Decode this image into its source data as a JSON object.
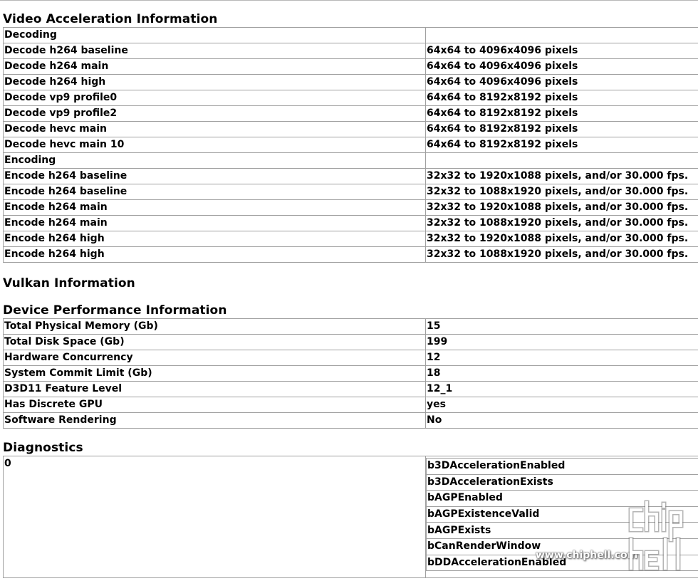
{
  "video_acceleration": {
    "heading": "Video Acceleration Information",
    "rows": [
      {
        "name": "Decoding",
        "value": ""
      },
      {
        "name": "Decode h264 baseline",
        "value": "64x64 to 4096x4096 pixels"
      },
      {
        "name": "Decode h264 main",
        "value": "64x64 to 4096x4096 pixels"
      },
      {
        "name": "Decode h264 high",
        "value": "64x64 to 4096x4096 pixels"
      },
      {
        "name": "Decode vp9 profile0",
        "value": "64x64 to 8192x8192 pixels"
      },
      {
        "name": "Decode vp9 profile2",
        "value": "64x64 to 8192x8192 pixels"
      },
      {
        "name": "Decode hevc main",
        "value": "64x64 to 8192x8192 pixels"
      },
      {
        "name": "Decode hevc main 10",
        "value": "64x64 to 8192x8192 pixels"
      },
      {
        "name": "Encoding",
        "value": ""
      },
      {
        "name": "Encode h264 baseline",
        "value": "32x32 to 1920x1088 pixels, and/or 30.000 fps."
      },
      {
        "name": "Encode h264 baseline",
        "value": "32x32 to 1088x1920 pixels, and/or 30.000 fps."
      },
      {
        "name": "Encode h264 main",
        "value": "32x32 to 1920x1088 pixels, and/or 30.000 fps."
      },
      {
        "name": "Encode h264 main",
        "value": "32x32 to 1088x1920 pixels, and/or 30.000 fps."
      },
      {
        "name": "Encode h264 high",
        "value": "32x32 to 1920x1088 pixels, and/or 30.000 fps."
      },
      {
        "name": "Encode h264 high",
        "value": "32x32 to 1088x1920 pixels, and/or 30.000 fps."
      }
    ]
  },
  "vulkan": {
    "heading": "Vulkan Information"
  },
  "device_performance": {
    "heading": "Device Performance Information",
    "rows": [
      {
        "name": "Total Physical Memory (Gb)",
        "value": "15"
      },
      {
        "name": "Total Disk Space (Gb)",
        "value": "199"
      },
      {
        "name": "Hardware Concurrency",
        "value": "12"
      },
      {
        "name": "System Commit Limit (Gb)",
        "value": "18"
      },
      {
        "name": "D3D11 Feature Level",
        "value": "12_1"
      },
      {
        "name": "Has Discrete GPU",
        "value": "yes"
      },
      {
        "name": "Software Rendering",
        "value": "No"
      }
    ]
  },
  "diagnostics": {
    "heading": "Diagnostics",
    "key": "0",
    "items": [
      "b3DAccelerationEnabled",
      "b3DAccelerationExists",
      "bAGPEnabled",
      "bAGPExistenceValid",
      "bAGPExists",
      "bCanRenderWindow",
      "bDDAccelerationEnabled"
    ]
  },
  "watermark": {
    "text": "www.chiphell.com",
    "logo": "chip-hell-logo"
  }
}
